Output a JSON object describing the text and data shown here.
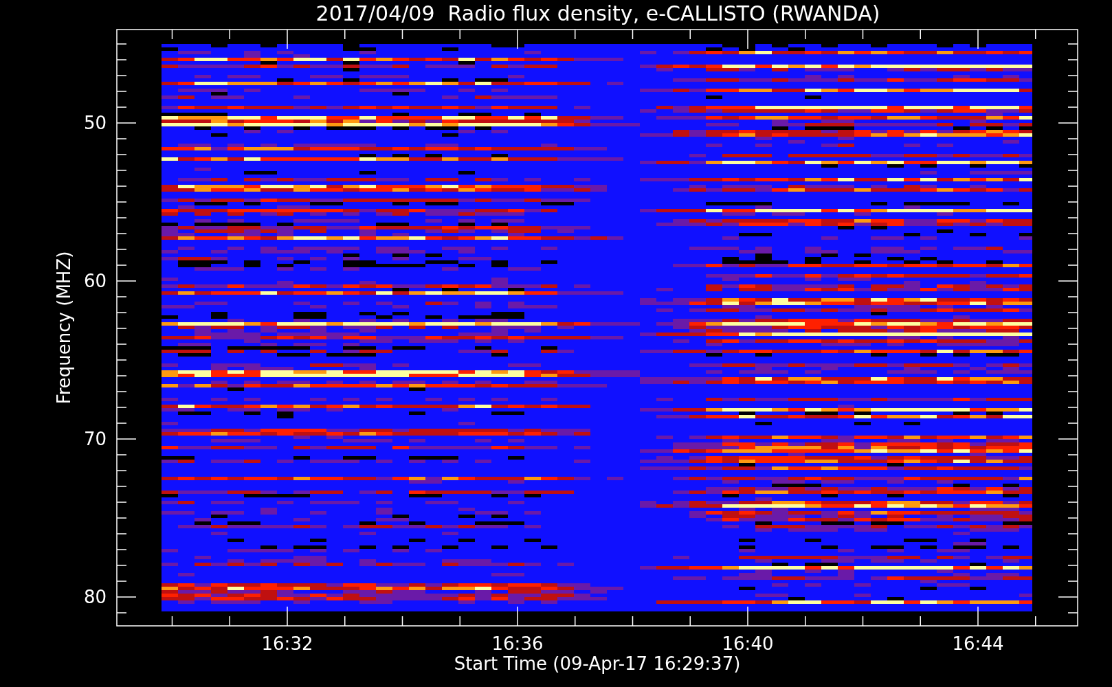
{
  "title": "2017/04/09  Radio flux density, e-CALLISTO (RWANDA)",
  "y_axis": {
    "label": "Frequency (MHZ)",
    "ticks": [
      "50",
      "60",
      "70",
      "80"
    ]
  },
  "x_axis": {
    "label": "Start Time (09-Apr-17 16:29:37)",
    "ticks": [
      "16:32",
      "16:36",
      "16:40",
      "16:44"
    ]
  }
}
